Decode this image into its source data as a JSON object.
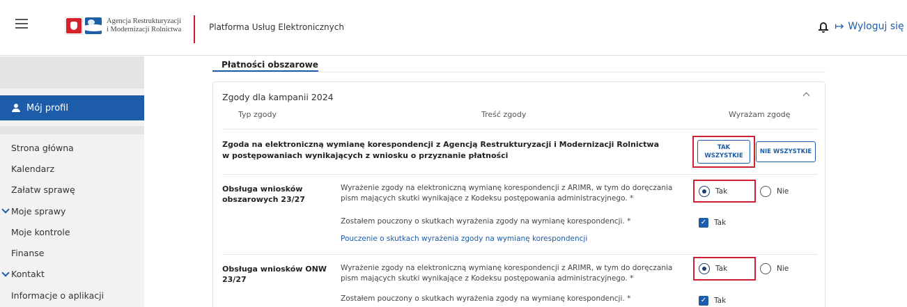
{
  "header": {
    "logo_line1": "Agencja Restrukturyzacji",
    "logo_line2": "i Modernizacji Rolnictwa",
    "platform_title": "Platforma Usług Elektronicznych",
    "logout_label": "Wyloguj się"
  },
  "sidebar": {
    "profile_label": "Mój profil",
    "items": [
      {
        "label": "Strona główna",
        "expandable": false
      },
      {
        "label": "Kalendarz",
        "expandable": false
      },
      {
        "label": "Załatw sprawę",
        "expandable": false
      },
      {
        "label": "Moje sprawy",
        "expandable": true
      },
      {
        "label": "Moje kontrole",
        "expandable": false
      },
      {
        "label": "Finanse",
        "expandable": false
      },
      {
        "label": "Kontakt",
        "expandable": true
      },
      {
        "label": "Informacje o aplikacji",
        "expandable": false
      }
    ]
  },
  "main": {
    "tab_label": "Płatności obszarowe",
    "card": {
      "title": "Zgody dla kampanii 2024",
      "col_type": "Typ zgody",
      "col_content": "Treść zgody",
      "col_consent": "Wyrażam zgodę",
      "all_consent_text": "Zgoda na elektroniczną wymianę korespondencji z Agencją Restrukturyzacji i Modernizacji Rolnictwa w postępowaniach wynikających z wniosku o przyznanie płatności",
      "btn_yes_all_line1": "TAK",
      "btn_yes_all_line2": "WSZYSTKIE",
      "btn_no_all": "NIE WSZYSTKIE",
      "rows": [
        {
          "name_line1": "Obsługa wniosków",
          "name_line2": "obszarowych 23/27",
          "consent_text": "Wyrażenie zgody na elektroniczną wymianę korespondencji z ARIMR, w tym do doręczania pism mających skutki wynikające z Kodeksu postępowania administracyjnego. *",
          "radio_yes": "Tak",
          "radio_no": "Nie",
          "selected": "Tak",
          "ack_text": "Zostałem pouczony o skutkach wyrażenia zgody na wymianę korespondencji. *",
          "ack_label": "Tak",
          "link": "Pouczenie o skutkach wyrażenia zgody na wymianę korespondencji"
        },
        {
          "name_line1": "Obsługa wniosków ONW",
          "name_line2": "23/27",
          "consent_text": "Wyrażenie zgody na elektroniczną wymianę korespondencji z ARIMR, w tym do doręczania pism mających skutki wynikające z Kodeksu postępowania administracyjnego. *",
          "radio_yes": "Tak",
          "radio_no": "Nie",
          "selected": "Tak",
          "ack_text": "Zostałem pouczony o skutkach wyrażenia zgody na wymianę korespondencji. *",
          "ack_label": "Tak"
        }
      ]
    }
  },
  "colors": {
    "accent_blue": "#1d5ca8",
    "highlight_red": "#cc1f2f",
    "separator_red": "#d7142a"
  }
}
